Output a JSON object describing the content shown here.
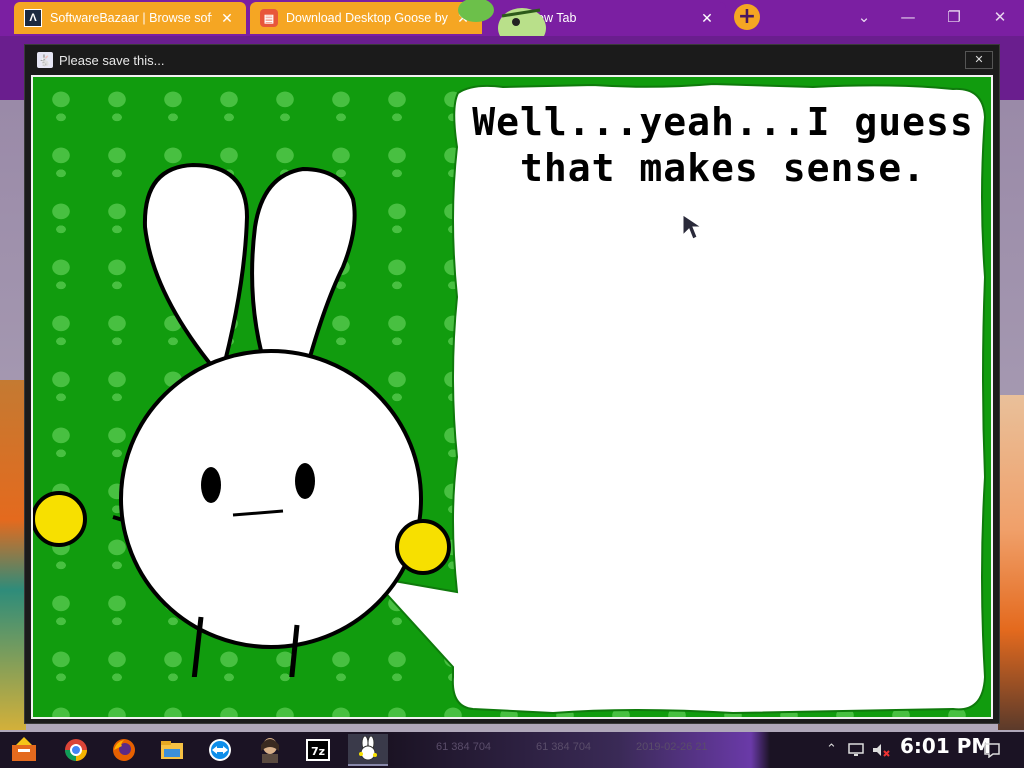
{
  "browser": {
    "tabs": [
      {
        "title": "SoftwareBazaar | Browse soft",
        "close": "✕"
      },
      {
        "title": "Download Desktop Goose by s",
        "close": "✕"
      },
      {
        "title": "New Tab",
        "close": "✕"
      }
    ],
    "new_tab_glyph": "+",
    "window_controls": {
      "chevron": "⌄",
      "minimize": "—",
      "restore": "❐",
      "close": "✕"
    }
  },
  "popup": {
    "title": "Please save this...",
    "close_glyph": "✕",
    "speech_line1": "Well...yeah...I guess",
    "speech_line2": "that makes sense."
  },
  "taskbar": {
    "ghost_text_1": "61 384 704",
    "ghost_text_2": "61 384 704",
    "ghost_text_3": "2019-02-26 21",
    "clock": "6:01 PM",
    "apps": [
      "start-icon",
      "chrome-icon",
      "firefox-icon",
      "file-explorer-icon",
      "teamviewer-icon",
      "portrait-app-icon",
      "7zip-icon",
      "bunny-app-icon"
    ],
    "tray_icons": [
      "chevron-up-icon",
      "network-icon",
      "volume-muted-icon",
      "notification-icon"
    ]
  },
  "colors": {
    "browser_purple": "#7b1fa2",
    "tab_orange": "#f5a623",
    "stage_green": "#119c0e",
    "skull_green": "#48c041",
    "bunny_hand_yellow": "#f7e000"
  }
}
